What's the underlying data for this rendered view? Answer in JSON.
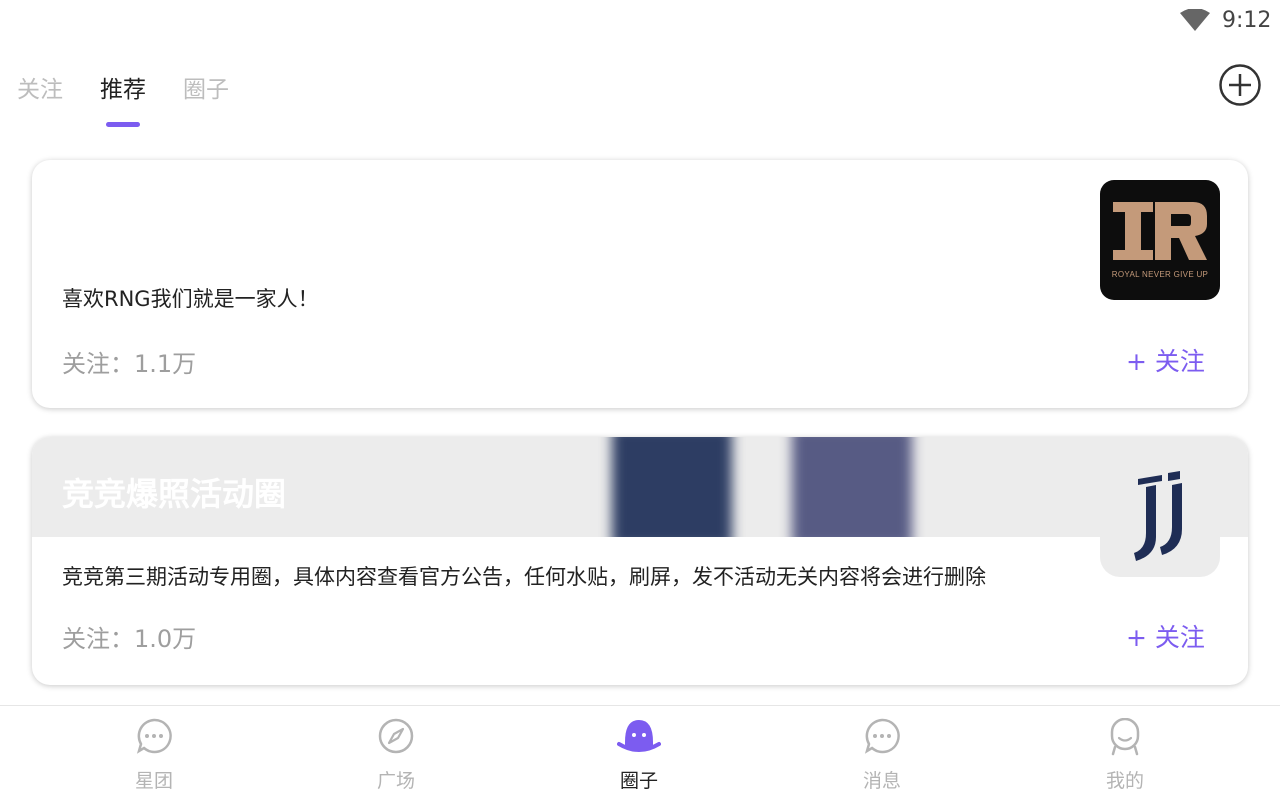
{
  "status_bar": {
    "time": "9:12"
  },
  "top_tabs": [
    {
      "label": "关注",
      "active": false
    },
    {
      "label": "推荐",
      "active": true
    },
    {
      "label": "圈子",
      "active": false
    }
  ],
  "accent_color": "#7c5cf0",
  "cards": [
    {
      "description": "喜欢RNG我们就是一家人！",
      "followers": "关注：1.1万",
      "follow_label": "+ 关注",
      "logo_icon": "rng-logo-icon",
      "logo_tagline": "ROYAL NEVER GIVE UP"
    },
    {
      "banner_title": "竞竞爆照活动圈",
      "description": "竞竞第三期活动专用圈，具体内容查看官方公告，任何水贴，刷屏，发不活动无关内容将会进行删除",
      "followers": "关注：1.0万",
      "follow_label": "+ 关注",
      "logo_icon": "juventus-logo-icon"
    }
  ],
  "bottom_nav": [
    {
      "label": "星团",
      "icon": "chat-bubble-icon",
      "active": false
    },
    {
      "label": "广场",
      "icon": "compass-icon",
      "active": false
    },
    {
      "label": "圈子",
      "icon": "ghost-icon",
      "active": true
    },
    {
      "label": "消息",
      "icon": "chat-bubble-icon",
      "active": false
    },
    {
      "label": "我的",
      "icon": "person-icon",
      "active": false
    }
  ]
}
